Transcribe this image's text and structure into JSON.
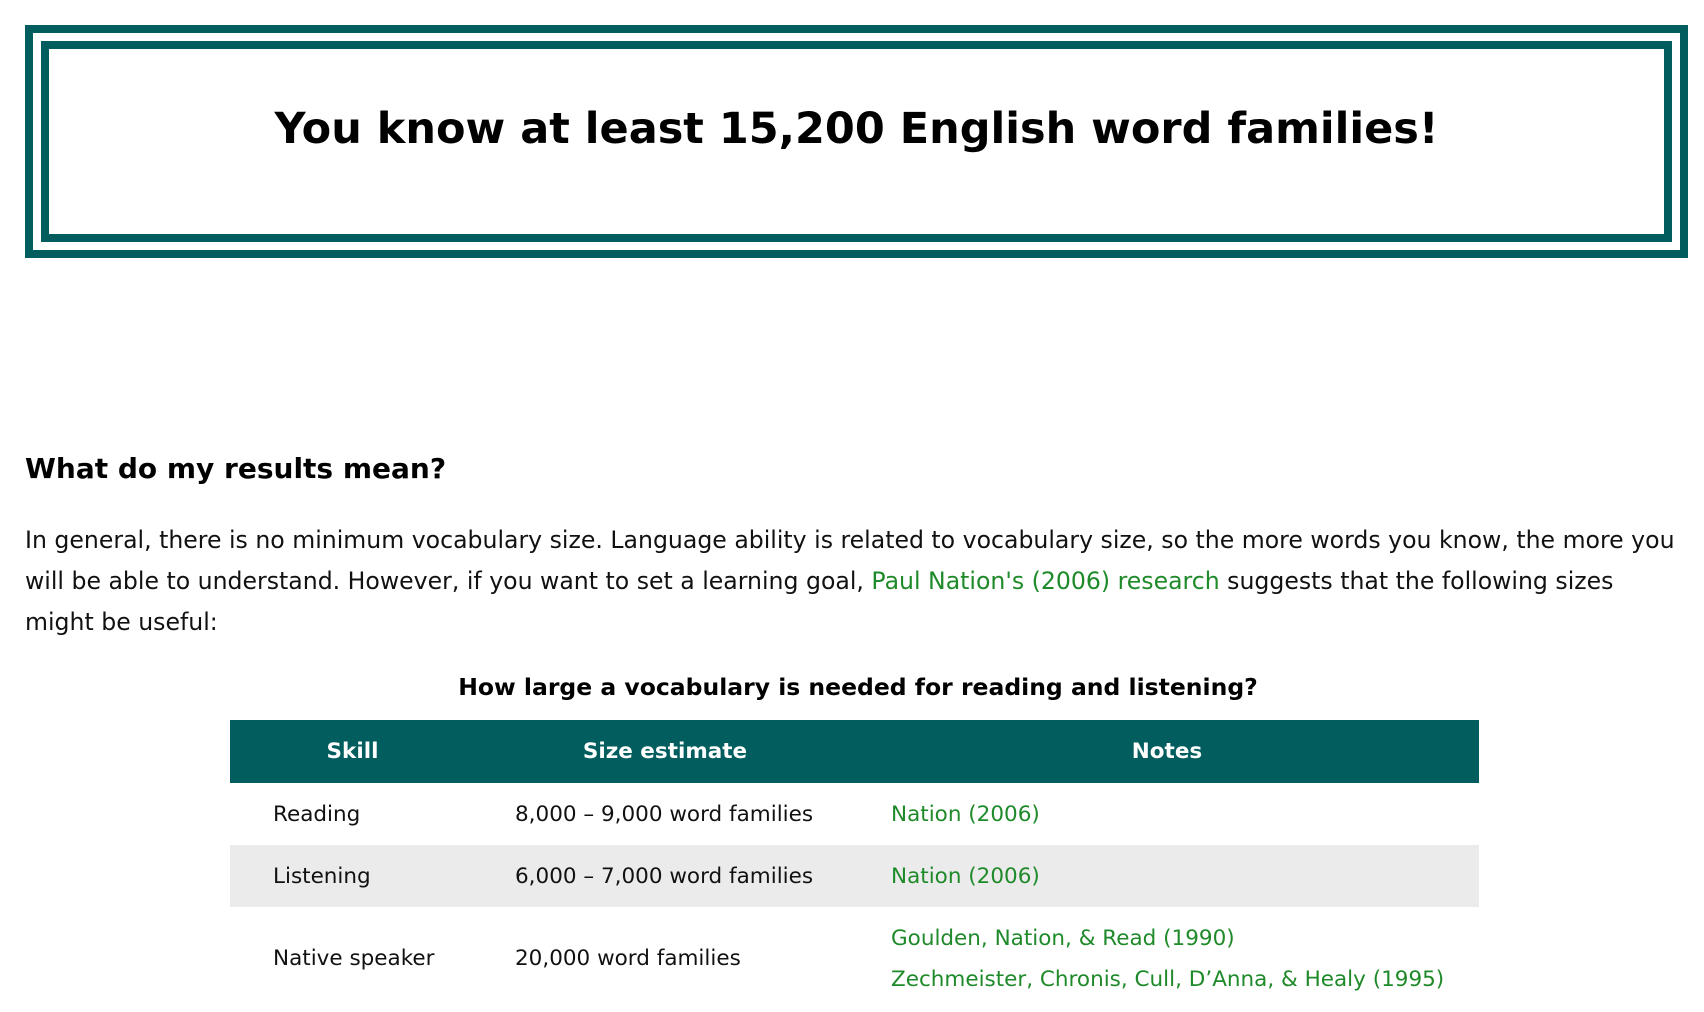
{
  "result": {
    "title": "You know at least 15,200 English word families!"
  },
  "section": {
    "heading": "What do my results mean?",
    "intro_before": "In general, there is no minimum vocabulary size. Language ability is related to vocabulary size, so the more words you know, the more you will be able to understand. However, if you want to set a learning goal, ",
    "intro_link": "Paul Nation's (2006) research",
    "intro_after": " suggests that the following sizes might be useful:"
  },
  "table": {
    "caption": "How large a vocabulary is needed for reading and listening?",
    "headers": [
      "Skill",
      "Size estimate",
      "Notes"
    ],
    "rows": [
      {
        "skill": "Reading",
        "size": "8,000 – 9,000 word families",
        "notes": [
          "Nation (2006)"
        ]
      },
      {
        "skill": "Listening",
        "size": "6,000 – 7,000 word families",
        "notes": [
          "Nation (2006)"
        ]
      },
      {
        "skill": "Native speaker",
        "size": "20,000 word families",
        "notes": [
          "Goulden, Nation, & Read (1990)",
          "Zechmeister, Chronis, Cull, D’Anna, & Healy (1995)"
        ]
      }
    ]
  },
  "colors": {
    "accent": "#015d5e",
    "link": "#1f8a2a",
    "row_alt": "#ebebeb"
  }
}
